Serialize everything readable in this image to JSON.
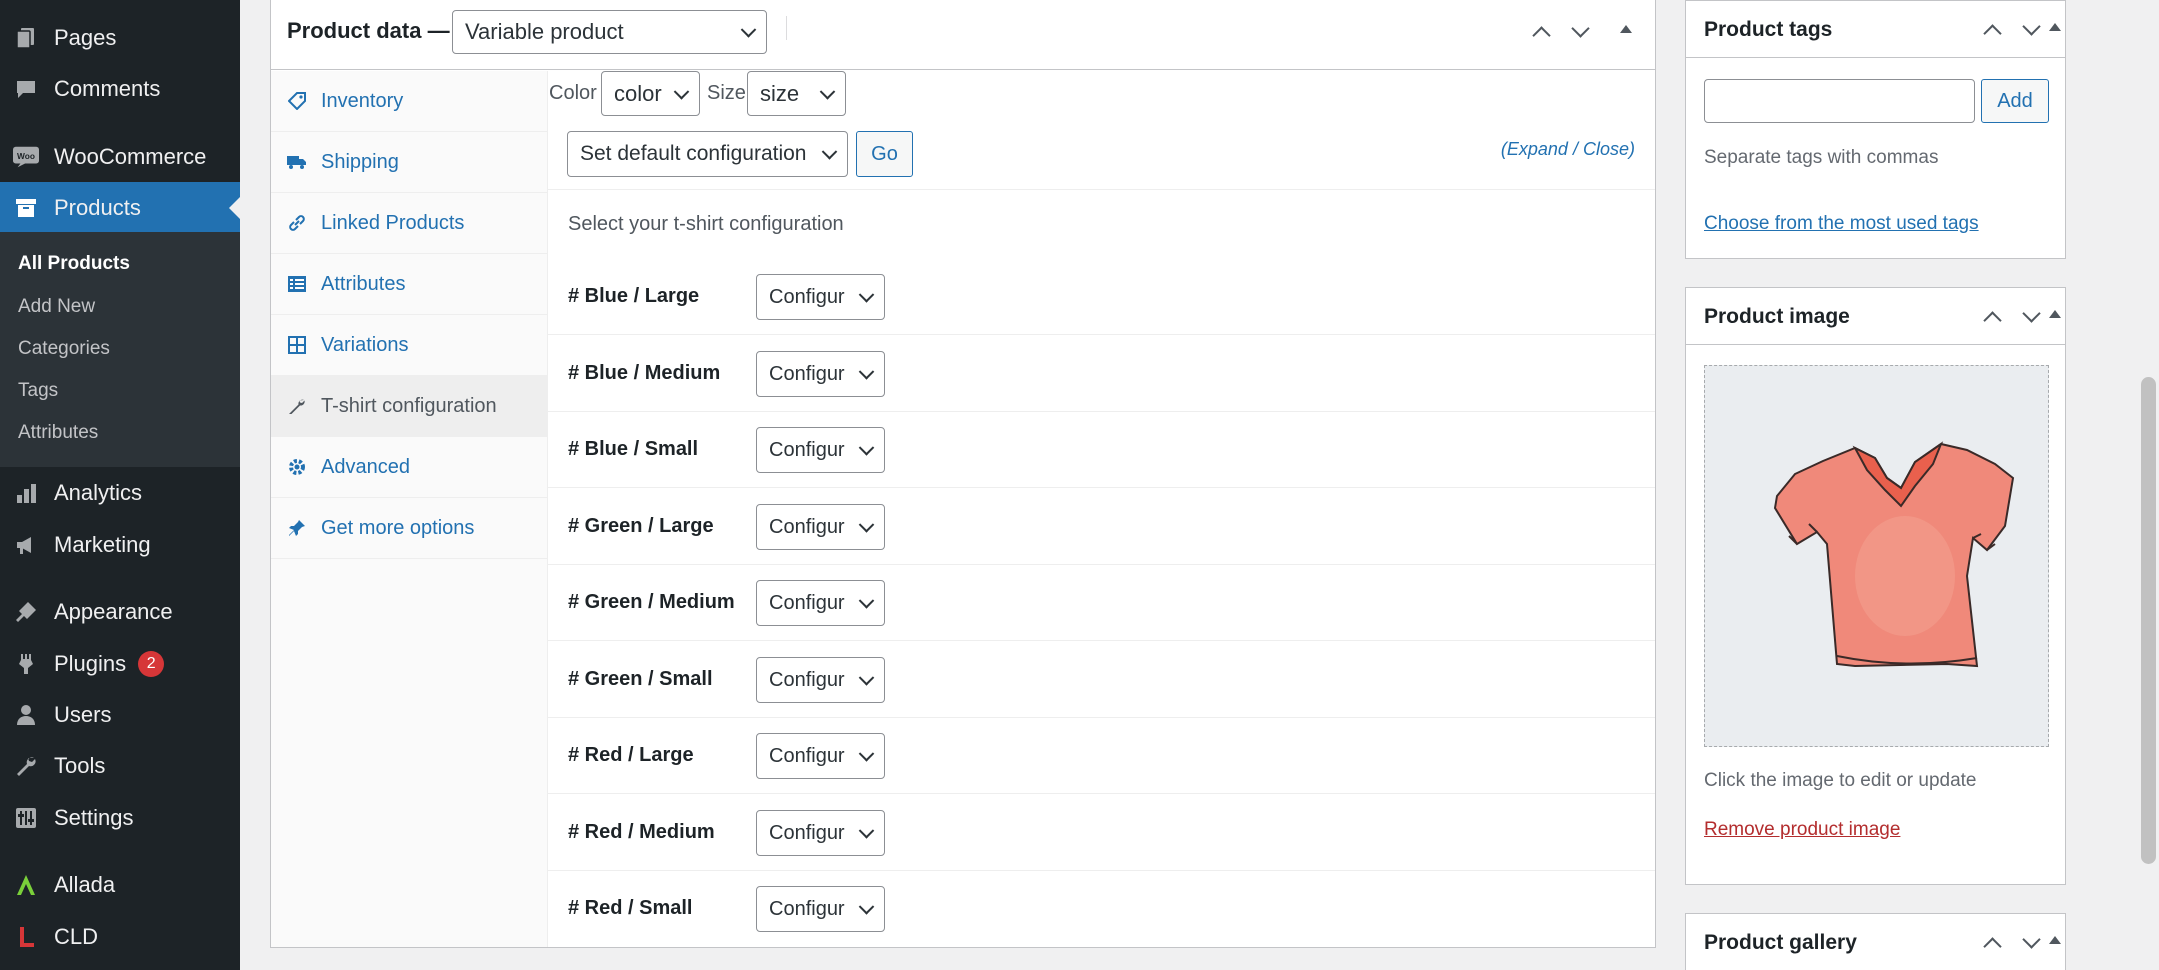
{
  "sidebar": {
    "items": [
      {
        "label": "Pages",
        "icon": "pages-icon"
      },
      {
        "label": "Comments",
        "icon": "comments-icon"
      },
      {
        "label": "WooCommerce",
        "icon": "woocommerce-icon"
      },
      {
        "label": "Products",
        "icon": "products-icon"
      },
      {
        "label": "Analytics",
        "icon": "analytics-icon"
      },
      {
        "label": "Marketing",
        "icon": "marketing-icon"
      },
      {
        "label": "Appearance",
        "icon": "appearance-icon"
      },
      {
        "label": "Plugins",
        "icon": "plugins-icon",
        "badge": "2"
      },
      {
        "label": "Users",
        "icon": "users-icon"
      },
      {
        "label": "Tools",
        "icon": "tools-icon"
      },
      {
        "label": "Settings",
        "icon": "settings-icon"
      },
      {
        "label": "Allada",
        "icon": "allada-icon"
      },
      {
        "label": "CLD",
        "icon": "cld-icon"
      }
    ],
    "submenu": [
      "All Products",
      "Add New",
      "Categories",
      "Tags",
      "Attributes"
    ],
    "accent": "#2271b1",
    "badge_color": "#d63638"
  },
  "product_data": {
    "title": "Product data —",
    "product_type": "Variable product",
    "tabs": [
      {
        "label": "Inventory",
        "icon": "tag-icon"
      },
      {
        "label": "Shipping",
        "icon": "truck-icon"
      },
      {
        "label": "Linked Products",
        "icon": "link-icon"
      },
      {
        "label": "Attributes",
        "icon": "list-icon"
      },
      {
        "label": "Variations",
        "icon": "grid-icon"
      },
      {
        "label": "T-shirt configuration",
        "icon": "wrench-icon"
      },
      {
        "label": "Advanced",
        "icon": "gear-icon"
      },
      {
        "label": "Get more options",
        "icon": "plugin-icon"
      }
    ],
    "active_tab": "T-shirt configuration",
    "filters": {
      "color_label": "Color",
      "color_value": "color",
      "size_label": "Size",
      "size_value": "size"
    },
    "bulk_action": "Set default configuration",
    "go_label": "Go",
    "expand_label": "Expand",
    "close_label": "Close",
    "description": "Select your t-shirt configuration",
    "rows": [
      {
        "name": "# Blue / Large",
        "value": "Configur"
      },
      {
        "name": "# Blue / Medium",
        "value": "Configur"
      },
      {
        "name": "# Blue / Small",
        "value": "Configur"
      },
      {
        "name": "# Green / Large",
        "value": "Configur"
      },
      {
        "name": "# Green / Medium",
        "value": "Configur"
      },
      {
        "name": "# Green / Small",
        "value": "Configur"
      },
      {
        "name": "# Red / Large",
        "value": "Configur"
      },
      {
        "name": "# Red / Medium",
        "value": "Configur"
      },
      {
        "name": "# Red / Small",
        "value": "Configur"
      }
    ]
  },
  "product_tags": {
    "title": "Product tags",
    "add_label": "Add",
    "help": "Separate tags with commas",
    "choose_link": "Choose from the most used tags"
  },
  "product_image": {
    "title": "Product image",
    "help": "Click the image to edit or update",
    "remove_link": "Remove product image",
    "image": "t-shirt-image"
  },
  "product_gallery": {
    "title": "Product gallery"
  }
}
